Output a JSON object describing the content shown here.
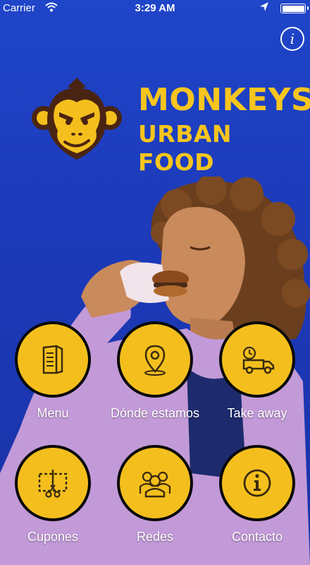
{
  "status_bar": {
    "carrier": "Carrier",
    "time": "3:29 AM"
  },
  "info_button": {
    "icon": "info-icon",
    "glyph": "i"
  },
  "brand": {
    "line1": "MONKEYS",
    "line2": "URBAN FOOD",
    "color": "#f7c51e"
  },
  "colors": {
    "background": "#1f45c9",
    "accent": "#f4bf1d",
    "ring": "#080808",
    "label": "#ffffff"
  },
  "grid": [
    {
      "label": "Menu",
      "icon": "menu-book-icon"
    },
    {
      "label": "Dónde estamos",
      "icon": "location-pin-icon"
    },
    {
      "label": "Take away",
      "icon": "delivery-truck-icon"
    },
    {
      "label": "Cupones",
      "icon": "scissors-coupon-icon"
    },
    {
      "label": "Redes",
      "icon": "people-icon"
    },
    {
      "label": "Contacto",
      "icon": "info-icon"
    }
  ]
}
